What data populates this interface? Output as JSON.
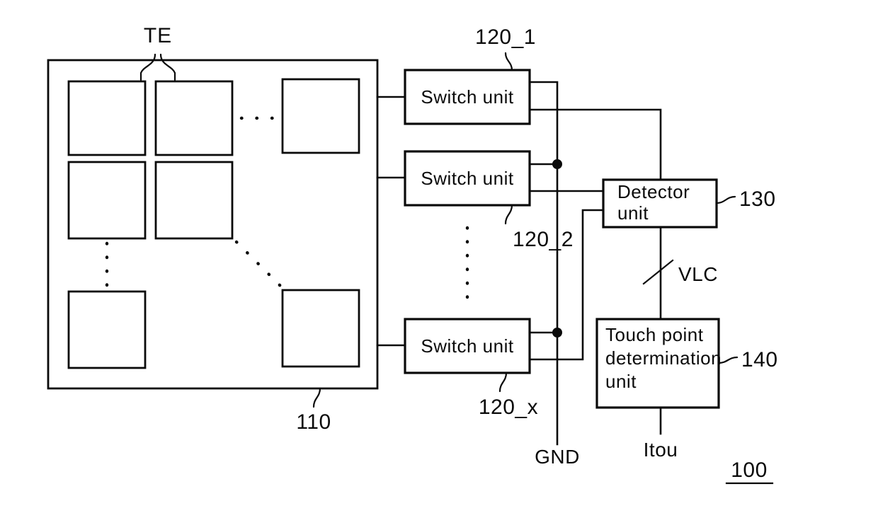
{
  "figure": {
    "reference_number": "100",
    "underlined": true
  },
  "panel": {
    "label": "110",
    "electrode_group_label": "TE"
  },
  "switch_units": [
    {
      "label": "Switch unit",
      "ref": "120_1"
    },
    {
      "label": "Switch unit",
      "ref": "120_2"
    },
    {
      "label": "Switch unit",
      "ref": "120_x"
    }
  ],
  "detector": {
    "label_line1": "Detector",
    "label_line2": "unit",
    "ref": "130"
  },
  "touch_point_unit": {
    "label_line1": "Touch point",
    "label_line2": "determination",
    "label_line3": "unit",
    "ref": "140"
  },
  "signals": {
    "ground": "GND",
    "vlc": "VLC",
    "itou": "Itou"
  },
  "colors": {
    "ink": "#0a0a0a",
    "background": "#ffffff"
  }
}
